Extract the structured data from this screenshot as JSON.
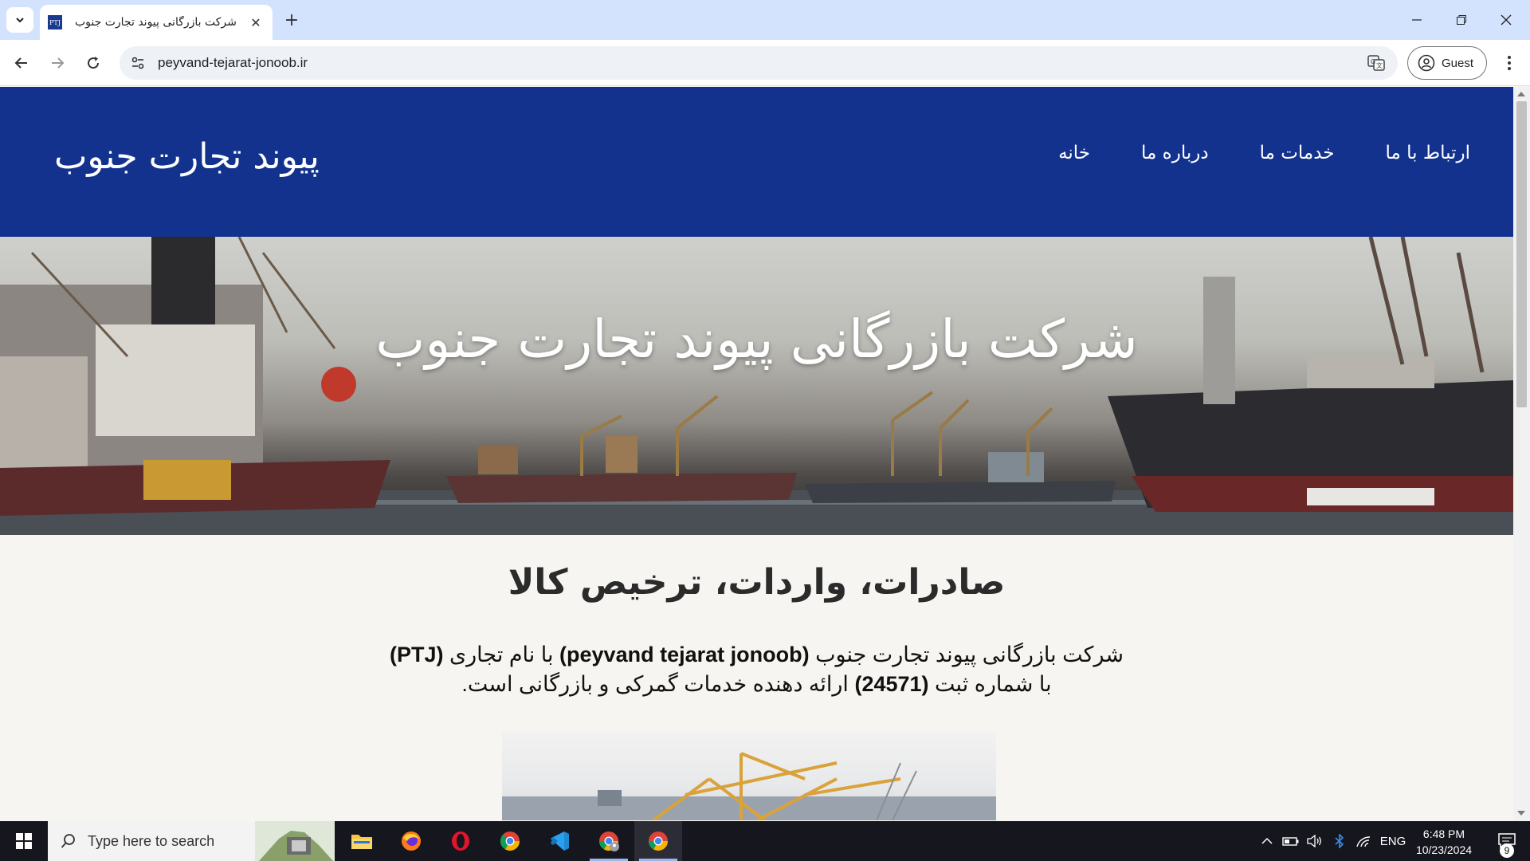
{
  "browser": {
    "tab": {
      "favicon_text": "PTJ",
      "title": "شرکت بازرگانی پیوند تجارت جنوب"
    },
    "address": "peyvand-tejarat-jonoob.ir",
    "profile_label": "Guest"
  },
  "site": {
    "logo": "پیوند تجارت جنوب",
    "nav": [
      "خانه",
      "درباره ما",
      "خدمات ما",
      "ارتباط با ما"
    ],
    "hero_title": "شرکت بازرگانی پیوند تجارت جنوب",
    "section_title": "صادرات، واردات، ترخیص کالا",
    "intro": {
      "line1_a": "شرکت بازرگانی پیوند تجارت جنوب ",
      "line1_b": "(peyvand tejarat jonoob)",
      "line1_c": " با نام تجاری ",
      "line1_d": "(PTJ)",
      "line2_a": "با شماره ثبت ",
      "line2_b": "(24571)",
      "line2_c": " ارائه دهنده خدمات گمرکی و بازرگانی است."
    }
  },
  "taskbar": {
    "search_placeholder": "Type here to search",
    "apps": [
      "file-explorer",
      "firefox",
      "opera",
      "chrome",
      "vscode",
      "chrome-profile",
      "chrome-active"
    ],
    "language": "ENG",
    "time": "6:48 PM",
    "date": "10/23/2024",
    "notification_count": "9"
  },
  "colors": {
    "header_bg": "#12328e",
    "page_bg": "#f6f5f1",
    "chrome_frame": "#d3e3fd"
  }
}
